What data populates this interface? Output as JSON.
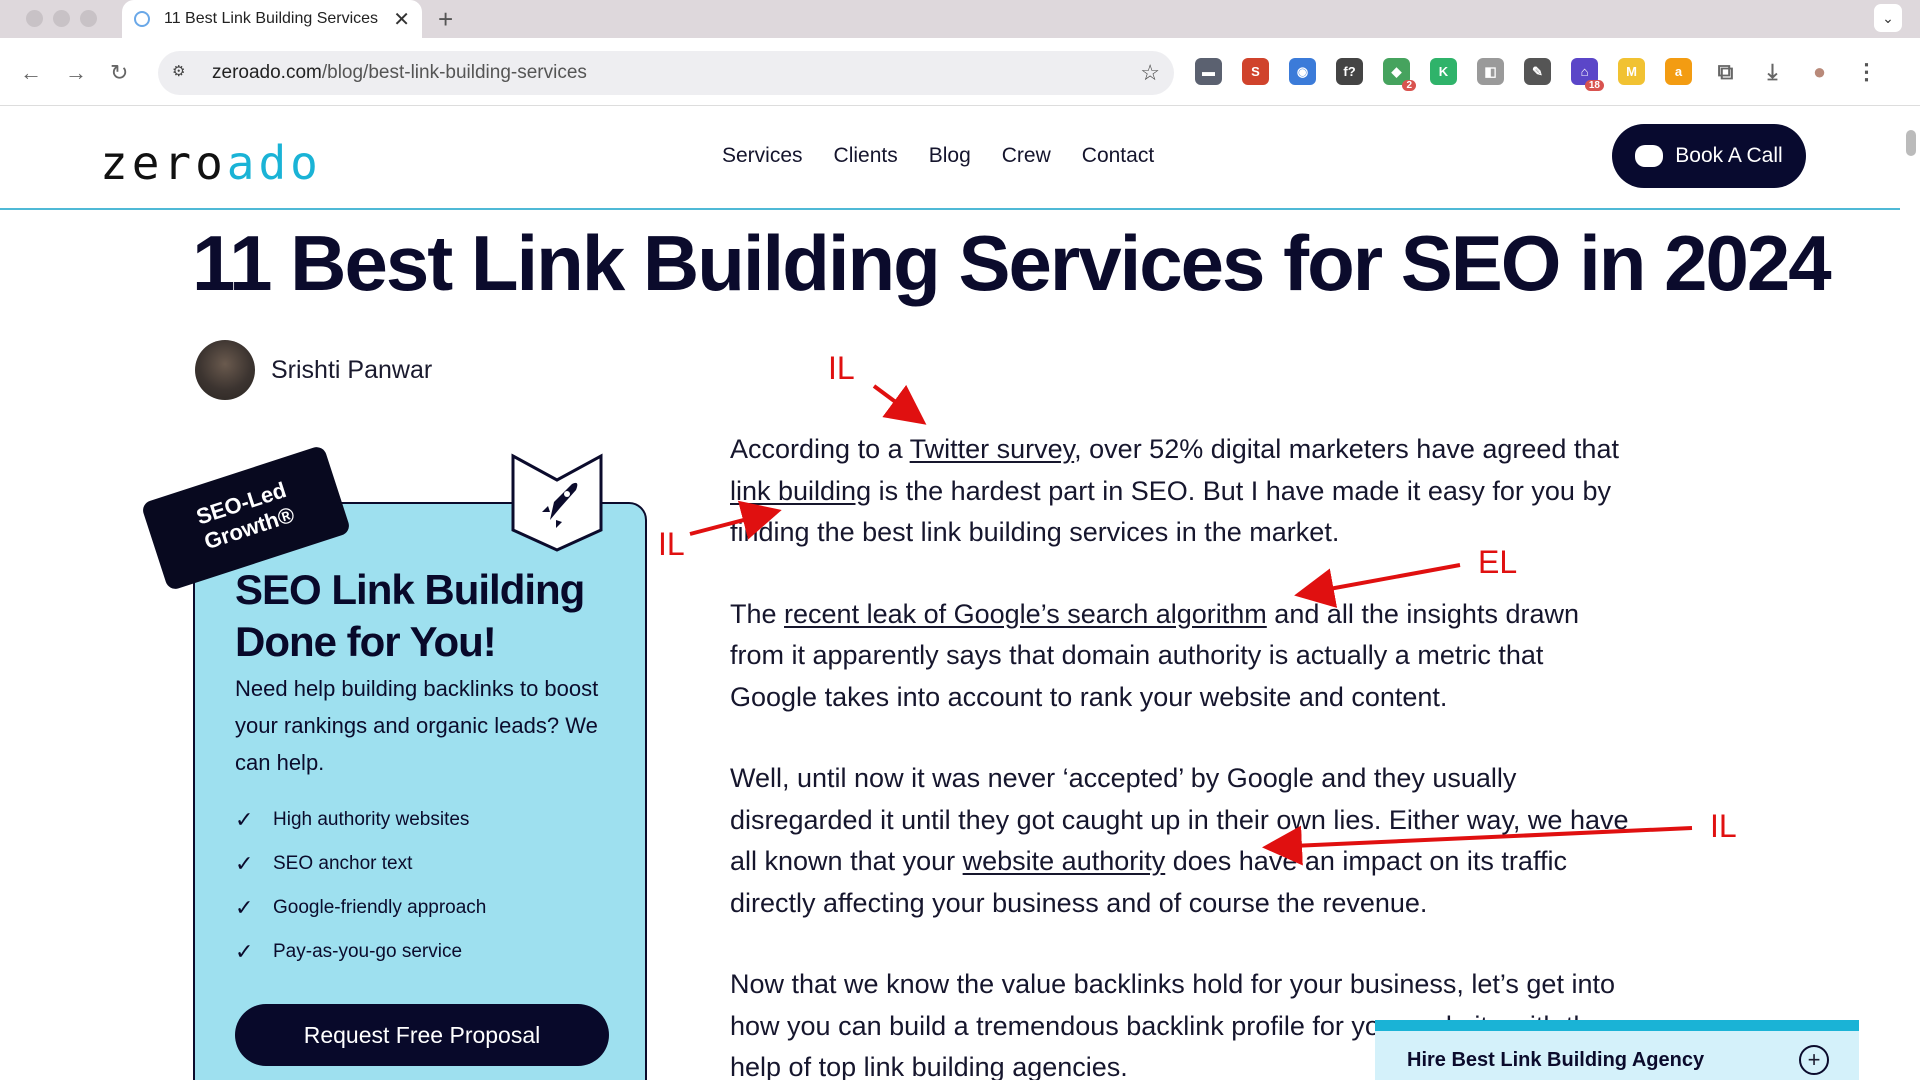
{
  "browser": {
    "tab_title": "11 Best Link Building Services",
    "tab_close": "✕",
    "new_tab": "+",
    "tab_menu": "⌄",
    "url_host": "zeroado.com",
    "url_path": "/blog/best-link-building-services",
    "nav": {
      "back": "←",
      "forward": "→",
      "reload": "↻",
      "star": "☆"
    },
    "extensions": [
      {
        "name": "folder-icon",
        "label": "▬",
        "color": "#5b6170",
        "badge": ""
      },
      {
        "name": "seo-extension-icon",
        "label": "S",
        "color": "#d0432c",
        "badge": ""
      },
      {
        "name": "chrome-color-icon",
        "label": "◉",
        "color": "#3b7bd9",
        "badge": ""
      },
      {
        "name": "font-extension-icon",
        "label": "f?",
        "color": "#444444",
        "badge": ""
      },
      {
        "name": "multi-extension-icon",
        "label": "◆",
        "color": "#46a35e",
        "badge": "2"
      },
      {
        "name": "k-extension-icon",
        "label": "K",
        "color": "#2fb36a",
        "badge": ""
      },
      {
        "name": "puzzle-grey-icon",
        "label": "◧",
        "color": "#9a9a9a",
        "badge": ""
      },
      {
        "name": "pen-icon",
        "label": "✎",
        "color": "#555555",
        "badge": ""
      },
      {
        "name": "home-extension-icon",
        "label": "⌂",
        "color": "#5b46c8",
        "badge": "18"
      },
      {
        "name": "m-extension-icon",
        "label": "M",
        "color": "#f1c232",
        "badge": ""
      },
      {
        "name": "a-extension-icon",
        "label": "a",
        "color": "#f39c12",
        "badge": ""
      },
      {
        "name": "extensions-puzzle-icon",
        "label": "⧉",
        "color": "#666666",
        "badge": ""
      },
      {
        "name": "download-icon",
        "label": "⤓",
        "color": "#666666",
        "badge": ""
      },
      {
        "name": "profile-avatar-icon",
        "label": "●",
        "color": "#b98a7a",
        "badge": ""
      },
      {
        "name": "menu-kebab-icon",
        "label": "⋮",
        "color": "#555555",
        "badge": ""
      }
    ]
  },
  "site": {
    "logo_main": "zero",
    "logo_accent": "ado",
    "nav": [
      "Services",
      "Clients",
      "Blog",
      "Crew",
      "Contact"
    ],
    "book_button": "Book A Call",
    "accent_color": "#1ab3d6",
    "dark_color": "#08092a"
  },
  "post": {
    "title": "11 Best Link Building Services for SEO in 2024",
    "author": "Srishti Panwar"
  },
  "promo": {
    "tag": "SEO-Led Growth®",
    "title_line1": "SEO Link Building",
    "title_line2": "Done for You!",
    "description": "Need help building backlinks to boost your rankings and organic leads? We can help.",
    "features": [
      "High authority websites",
      "SEO anchor text",
      "Google-friendly approach",
      "Pay-as-you-go service"
    ],
    "cta": "Request Free Proposal"
  },
  "article": {
    "p1": {
      "t1": "According to a ",
      "link1": "Twitter survey",
      "t2": ", over 52% digital marketers have agreed that ",
      "link2": "link building",
      "t3": " is the hardest part in SEO. But I have made it easy for you by finding the best link building services in the market."
    },
    "p2": {
      "t1": "The ",
      "link1": "recent leak of Google’s search algorithm",
      "t2": " and all the insights drawn from it apparently says that domain authority is actually a metric that Google takes into account to rank your website and content."
    },
    "p3": {
      "t1": "Well, until now it was never ‘accepted’ by Google and they usually disregarded it until they got caught up in their own lies. Either way, we have all known that your ",
      "link1": "website authority",
      "t2": " does have an impact on its traffic directly affecting your business and of course the revenue."
    },
    "p4": {
      "t1": "Now that we know the value backlinks hold for your business, let’s get into how you can build a tremendous backlink profile for your website with the help of top link building agencies."
    }
  },
  "hire_box": {
    "label": "Hire Best Link Building Agency",
    "plus": "+"
  },
  "annotations": {
    "il_top": "IL",
    "il_left": "IL",
    "el": "EL",
    "il_right": "IL",
    "color": "#e01010"
  }
}
